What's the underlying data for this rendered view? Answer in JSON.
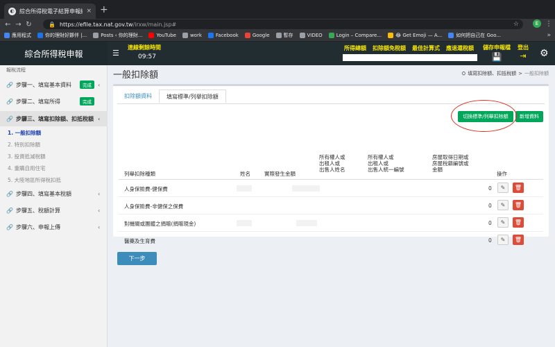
{
  "browser": {
    "tab_title": "綜合所得稅電子結算申報繳稅系",
    "tab_close": "×",
    "new_tab": "+",
    "url_host": "https://efile.tax.nat.gov.tw",
    "url_path": "/irxw/main.jsp#",
    "avatar_letter": "E",
    "bookmarks": [
      {
        "label": "應用程式",
        "color": "#4285f4"
      },
      {
        "label": "你的理財好夥伴 |...",
        "color": "#1a73e8"
      },
      {
        "label": "Posts ‹ 你的理財...",
        "color": "#9aa0a6"
      },
      {
        "label": "YouTube",
        "color": "#ff0000"
      },
      {
        "label": "work",
        "color": "#9aa0a6"
      },
      {
        "label": "Facebook",
        "color": "#1877f2"
      },
      {
        "label": "Google",
        "color": "#ea4335"
      },
      {
        "label": "暫存",
        "color": "#9aa0a6"
      },
      {
        "label": "VIDEO",
        "color": "#9aa0a6"
      },
      {
        "label": "Login – Compare...",
        "color": "#34a853"
      },
      {
        "label": "😂 Get Emoji — A...",
        "color": "#fbbc04"
      },
      {
        "label": "如何把自己在 Goo...",
        "color": "#4285f4"
      }
    ]
  },
  "header": {
    "brand": "綜合所得稅申報",
    "timer_label": "連線剩餘時間",
    "timer_value": "09:57",
    "links": [
      "所得總額",
      "扣除額免稅額",
      "最佳計算式",
      "應退還稅額"
    ],
    "save_label": "儲存申報檔",
    "logout_label": "登出"
  },
  "sidebar": {
    "heading": "報稅流程",
    "steps": [
      {
        "label": "步驟一、填寫基本資料",
        "badge": "完成"
      },
      {
        "label": "步驟二、填寫所得",
        "badge": "完成"
      },
      {
        "label": "步驟三、填寫扣除額、扣抵稅額",
        "badge": ""
      },
      {
        "label": "步驟四、填寫基本稅額",
        "badge": ""
      },
      {
        "label": "步驟五、稅額計算",
        "badge": ""
      },
      {
        "label": "步驟六、申報上傳",
        "badge": ""
      }
    ],
    "substeps": [
      "1. 一般扣除額",
      "2. 特別扣除額",
      "3. 投資抵減稅額",
      "4. 重購自用住宅",
      "5. 大陸地區所得稅扣抵"
    ]
  },
  "main": {
    "title": "一般扣除額",
    "breadcrumb_home": "填寫扣除額、扣抵稅額",
    "breadcrumb_sep": ">",
    "breadcrumb_current": "一般扣除額",
    "tabs": [
      "扣除額資料",
      "填寫標準/列舉扣除額"
    ],
    "switch_button": "切換標準/列舉扣除額",
    "add_button": "新增資料",
    "columns": {
      "c1": "列舉扣除種類",
      "c2": "姓名",
      "c3": "實際發生金額",
      "c4a": "所有權人或",
      "c4b": "出租人或",
      "c4c": "出售人姓名",
      "c5a": "所有權人或",
      "c5b": "出租人或",
      "c5c": "出售人統一編號",
      "c6a": "房屋取得日期或",
      "c6b": "房屋稅籍編號或",
      "c6c": "金額",
      "c7": "操作"
    },
    "rows": [
      {
        "type": "人身保險費-健保費",
        "value": "0"
      },
      {
        "type": "人身保險費-非健保之保費",
        "value": "0"
      },
      {
        "type": "對機關或團體之捐贈(捐贈現金)",
        "value": "0"
      },
      {
        "type": "醫藥及生育費",
        "value": "0"
      }
    ],
    "next_button": "下一步"
  }
}
